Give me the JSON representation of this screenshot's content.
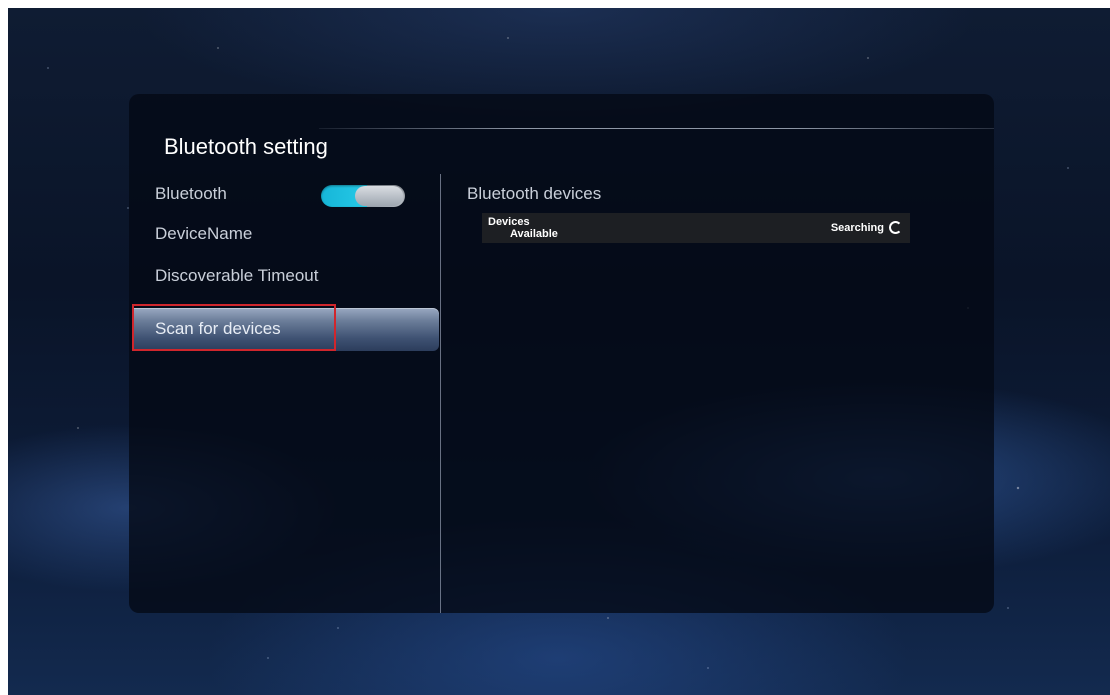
{
  "panel": {
    "title": "Bluetooth setting"
  },
  "menu": {
    "items": [
      {
        "label": "Bluetooth"
      },
      {
        "label": "DeviceName"
      },
      {
        "label": "Discoverable Timeout"
      },
      {
        "label": "Scan for devices",
        "selected": true
      }
    ]
  },
  "bluetooth_toggle": {
    "state": "on"
  },
  "devices_panel": {
    "title": "Bluetooth devices",
    "header_line1": "Devices",
    "header_line2": "Available",
    "status": "Searching"
  },
  "colors": {
    "toggle_on": "#26c9e6",
    "highlight": "#d0262c",
    "panel_bg": "#040914"
  },
  "icons": {
    "searching": "spinner-icon"
  }
}
